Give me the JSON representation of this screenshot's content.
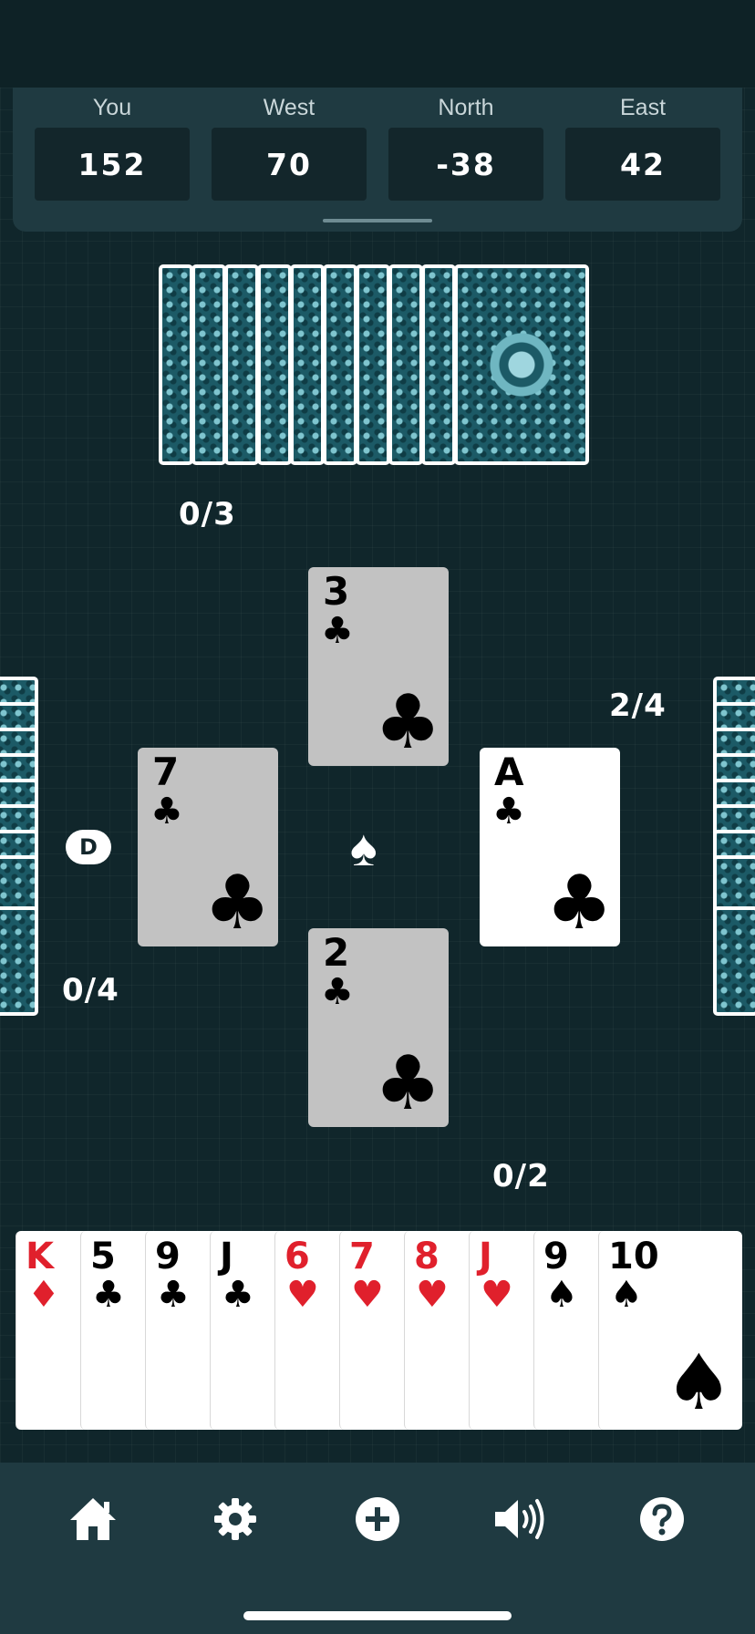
{
  "scoreboard": {
    "players": [
      {
        "name": "You",
        "score": "152"
      },
      {
        "name": "West",
        "score": "70"
      },
      {
        "name": "North",
        "score": "-38"
      },
      {
        "name": "East",
        "score": "42"
      }
    ]
  },
  "tricks": {
    "north": "0/3",
    "west": "0/4",
    "east": "2/4",
    "south": "0/2"
  },
  "table": {
    "north_card": {
      "rank": "3",
      "suit": "♣"
    },
    "west_card": {
      "rank": "7",
      "suit": "♣"
    },
    "east_card": {
      "rank": "A",
      "suit": "♣"
    },
    "south_card": {
      "rank": "2",
      "suit": "♣"
    },
    "trump_suit": "♠",
    "dealer_label": "D"
  },
  "hand": [
    {
      "rank": "K",
      "suit": "♦",
      "color": "red"
    },
    {
      "rank": "5",
      "suit": "♣",
      "color": "black"
    },
    {
      "rank": "9",
      "suit": "♣",
      "color": "black"
    },
    {
      "rank": "J",
      "suit": "♣",
      "color": "black"
    },
    {
      "rank": "6",
      "suit": "♥",
      "color": "red"
    },
    {
      "rank": "7",
      "suit": "♥",
      "color": "red"
    },
    {
      "rank": "8",
      "suit": "♥",
      "color": "red"
    },
    {
      "rank": "J",
      "suit": "♥",
      "color": "red"
    },
    {
      "rank": "9",
      "suit": "♠",
      "color": "black"
    },
    {
      "rank": "10",
      "suit": "♠",
      "color": "black"
    }
  ],
  "nav": {
    "home": "home-icon",
    "settings": "gear-icon",
    "new_game": "plus-circle-icon",
    "sound": "speaker-icon",
    "help": "question-icon"
  },
  "colors": {
    "background": "#10262b",
    "panel": "#1f3a41",
    "red_suit": "#e0202c",
    "card_back": "#1c5a66"
  }
}
